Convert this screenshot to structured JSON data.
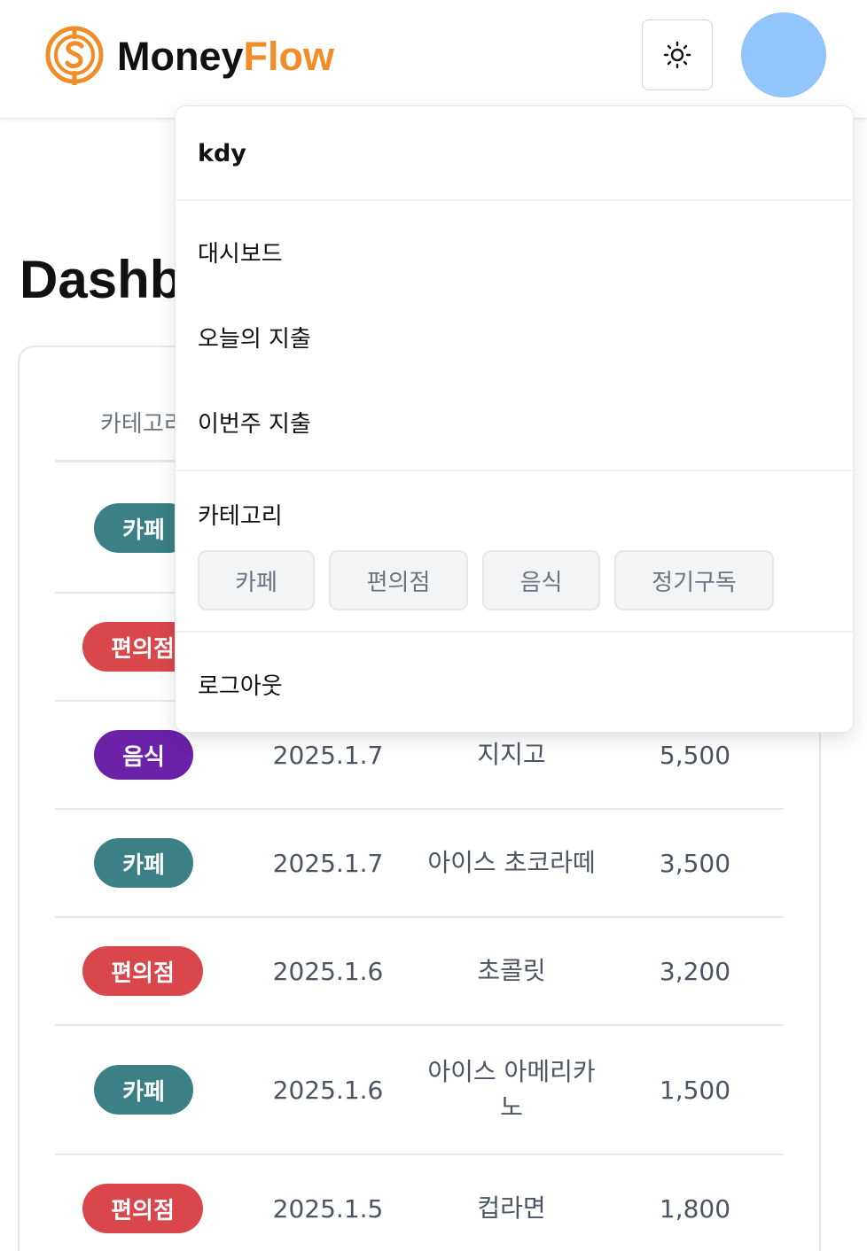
{
  "brand": {
    "name_part1": "Money",
    "name_part2": "Flow",
    "accent_color": "#f28c28"
  },
  "header": {
    "theme_toggle_icon": "sun-icon",
    "avatar_color": "#93c5fd"
  },
  "page": {
    "title": "Dashb"
  },
  "table": {
    "header_partial": "카테고리",
    "rows": [
      {
        "category": "카페",
        "color": "#3a8086",
        "date": "",
        "name": "",
        "amount": ""
      },
      {
        "category": "편의점",
        "color": "#d9464b",
        "date": "",
        "name": "",
        "amount": ""
      },
      {
        "category": "음식",
        "color": "#6b21a8",
        "date": "2025.1.7",
        "name": "지지고",
        "amount": "5,500"
      },
      {
        "category": "카페",
        "color": "#3a8086",
        "date": "2025.1.7",
        "name": "아이스 초코라떼",
        "amount": "3,500"
      },
      {
        "category": "편의점",
        "color": "#d9464b",
        "date": "2025.1.6",
        "name": "초콜릿",
        "amount": "3,200"
      },
      {
        "category": "카페",
        "color": "#3a8086",
        "date": "2025.1.6",
        "name_line1": "아이스 아메리카",
        "name_line2": "노",
        "amount": "1,500"
      },
      {
        "category": "편의점",
        "color": "#d9464b",
        "date": "2025.1.5",
        "name": "컵라면",
        "amount": "1,800"
      }
    ]
  },
  "menu": {
    "username": "kdy",
    "items": [
      "대시보드",
      "오늘의 지출",
      "이번주 지출"
    ],
    "category_label": "카테고리",
    "categories": [
      "카페",
      "편의점",
      "음식",
      "정기구독"
    ],
    "logout": "로그아웃"
  }
}
